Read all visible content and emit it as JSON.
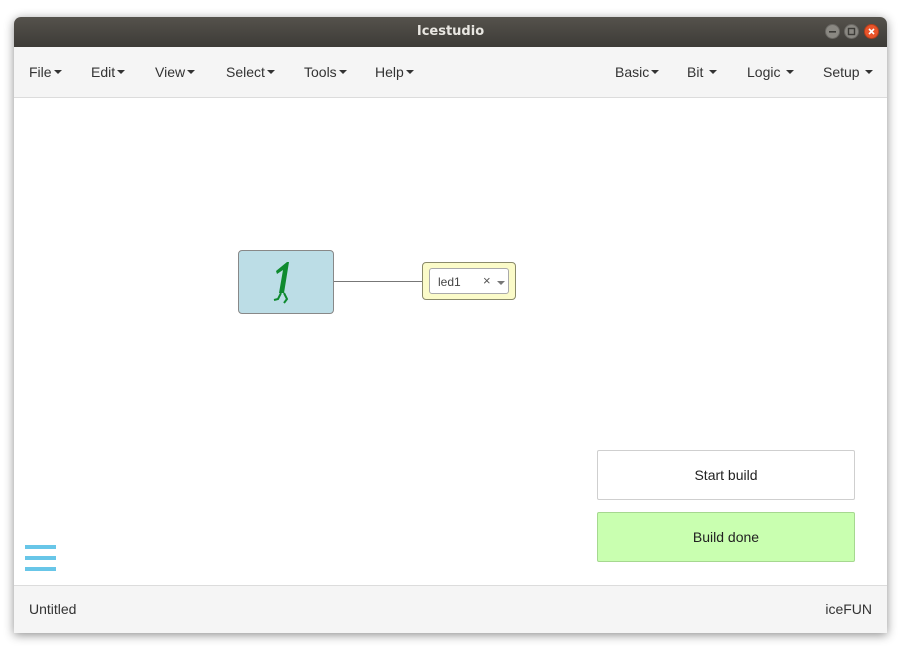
{
  "window": {
    "title": "Icestudio"
  },
  "menu": {
    "left": [
      {
        "label": "File"
      },
      {
        "label": "Edit"
      },
      {
        "label": "View"
      },
      {
        "label": "Select"
      },
      {
        "label": "Tools"
      },
      {
        "label": "Help"
      }
    ],
    "right": [
      {
        "label": "Basic"
      },
      {
        "label": "Bit"
      },
      {
        "label": "Logic"
      },
      {
        "label": "Setup"
      }
    ]
  },
  "canvas": {
    "constant_block": {
      "value_icon": "constant-1-icon",
      "fill_color": "#bcdde6"
    },
    "output_block": {
      "pin_label": "led1",
      "clear_symbol": "×",
      "fill_color": "#fbfbc9"
    }
  },
  "notifications": {
    "start": "Start build",
    "done": "Build done",
    "done_color": "#c9ffb0"
  },
  "footer": {
    "project_name": "Untitled",
    "board": "iceFUN"
  },
  "colors": {
    "accent": "#68c6e8",
    "titlebar": "#3d3b37",
    "close_button": "#e9542a"
  }
}
